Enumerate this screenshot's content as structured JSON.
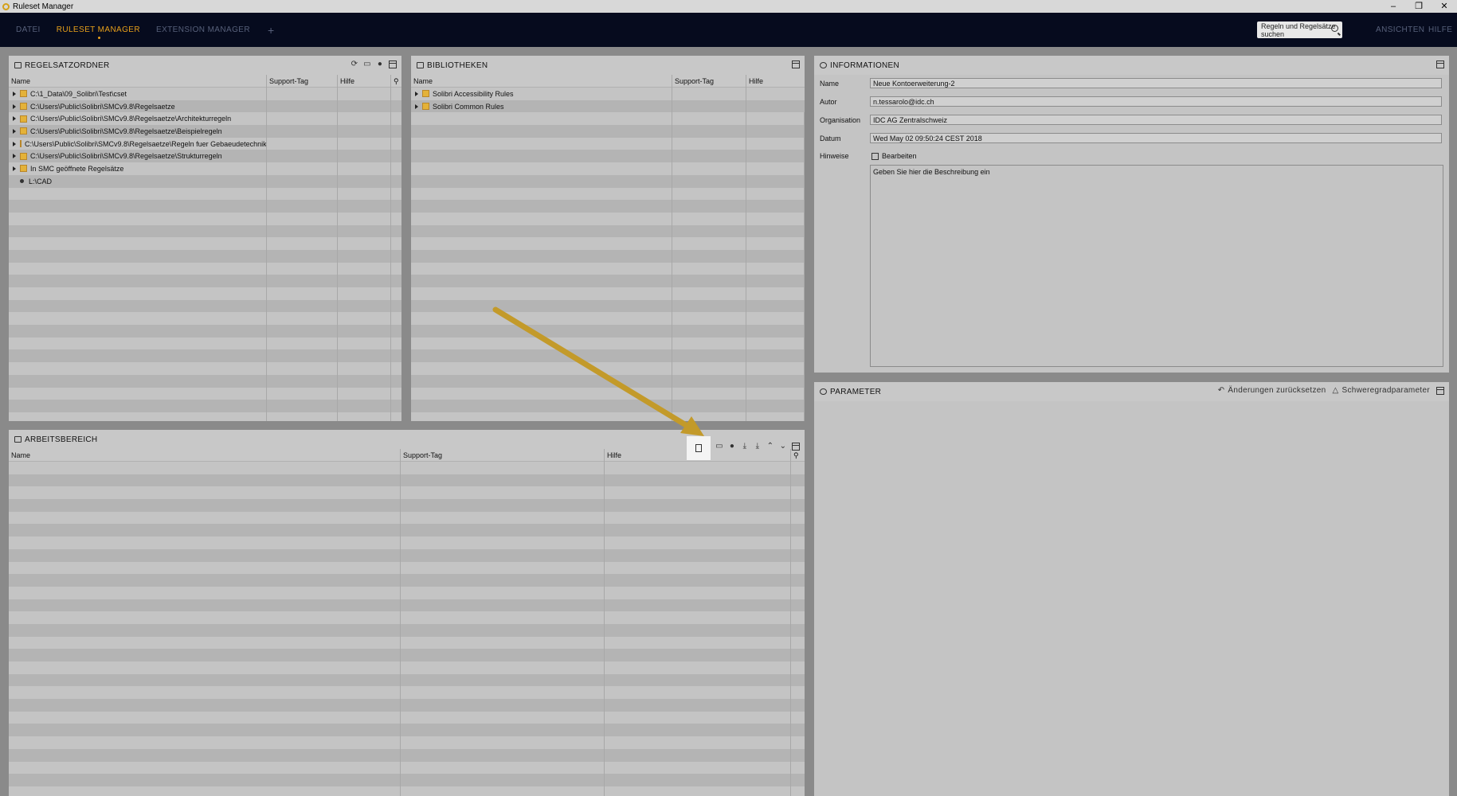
{
  "window": {
    "title": "Ruleset Manager",
    "controls": [
      "–",
      "❐",
      "✕"
    ]
  },
  "menu": {
    "items": [
      "DATEI",
      "RULESET MANAGER",
      "EXTENSION MANAGER"
    ],
    "plus": "+",
    "search_placeholder": "Regeln und Regelsätze suchen",
    "right": [
      "ANSICHTEN",
      "HILFE"
    ],
    "active_color": "#e8a01a"
  },
  "regelsatzordner": {
    "title": "REGELSATZORDNER",
    "columns": [
      "Name",
      "Support-Tag",
      "Hilfe"
    ],
    "rows": [
      "C:\\1_Data\\09_Solibri\\Test\\cset",
      "C:\\Users\\Public\\Solibri\\SMCv9.8\\Regelsaetze",
      "C:\\Users\\Public\\Solibri\\SMCv9.8\\Regelsaetze\\Architekturregeln",
      "C:\\Users\\Public\\Solibri\\SMCv9.8\\Regelsaetze\\Beispielregeln",
      "C:\\Users\\Public\\Solibri\\SMCv9.8\\Regelsaetze\\Regeln fuer Gebaeudetechnik",
      "C:\\Users\\Public\\Solibri\\SMCv9.8\\Regelsaetze\\Strukturregeln",
      "In SMC geöffnete Regelsätze",
      "L:\\CAD"
    ]
  },
  "bibliotheken": {
    "title": "BIBLIOTHEKEN",
    "columns": [
      "Name",
      "Support-Tag",
      "Hilfe"
    ],
    "rows": [
      "Solibri Accessibility Rules",
      "Solibri Common Rules"
    ]
  },
  "informationen": {
    "title": "INFORMATIONEN",
    "fields": [
      {
        "label": "Name",
        "value": "Neue Kontoerweiterung-2"
      },
      {
        "label": "Autor",
        "value": "n.tessarolo@idc.ch"
      },
      {
        "label": "Organisation",
        "value": "IDC AG Zentralschweiz"
      },
      {
        "label": "Datum",
        "value": "Wed May 02 09:50:24 CEST 2018"
      }
    ],
    "notes_label": "Hinweise",
    "edit_label": "Bearbeiten",
    "notes_placeholder": "Geben Sie hier die Beschreibung ein"
  },
  "parameter": {
    "title": "PARAMETER",
    "reset_label": "Änderungen zurücksetzen",
    "severity_label": "Schweregradparameter"
  },
  "arbeitsbereich": {
    "title": "ARBEITSBEREICH",
    "columns": [
      "Name",
      "Support-Tag",
      "Hilfe"
    ]
  },
  "annotation": {
    "arrow_color": "#c39a2a"
  }
}
